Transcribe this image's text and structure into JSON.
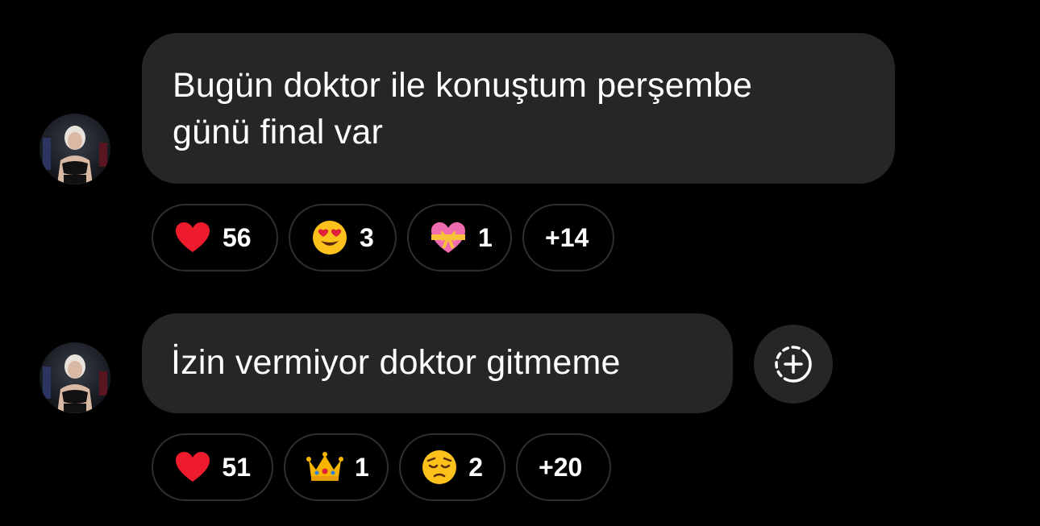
{
  "colors": {
    "background": "#000000",
    "bubble": "#262626",
    "pill_border": "#2f2f2f",
    "text": "#ffffff"
  },
  "messages": [
    {
      "avatar_icon": "user-avatar-icon",
      "lines": [
        "Bugün doktor ile konuştum perşembe",
        "günü final var"
      ],
      "reactions": [
        {
          "icon": "red-heart-icon",
          "count": "56"
        },
        {
          "icon": "heart-eyes-face-icon",
          "count": "3"
        },
        {
          "icon": "heart-with-ribbon-icon",
          "count": "1"
        }
      ],
      "more": "+14"
    },
    {
      "avatar_icon": "user-avatar-icon",
      "lines": [
        "İzin vermiyor doktor gitmeme"
      ],
      "add_reaction_icon": "add-reaction-icon",
      "reactions": [
        {
          "icon": "red-heart-icon",
          "count": "51"
        },
        {
          "icon": "crown-icon",
          "count": "1"
        },
        {
          "icon": "pensive-face-icon",
          "count": "2"
        }
      ],
      "more": "+20"
    }
  ]
}
